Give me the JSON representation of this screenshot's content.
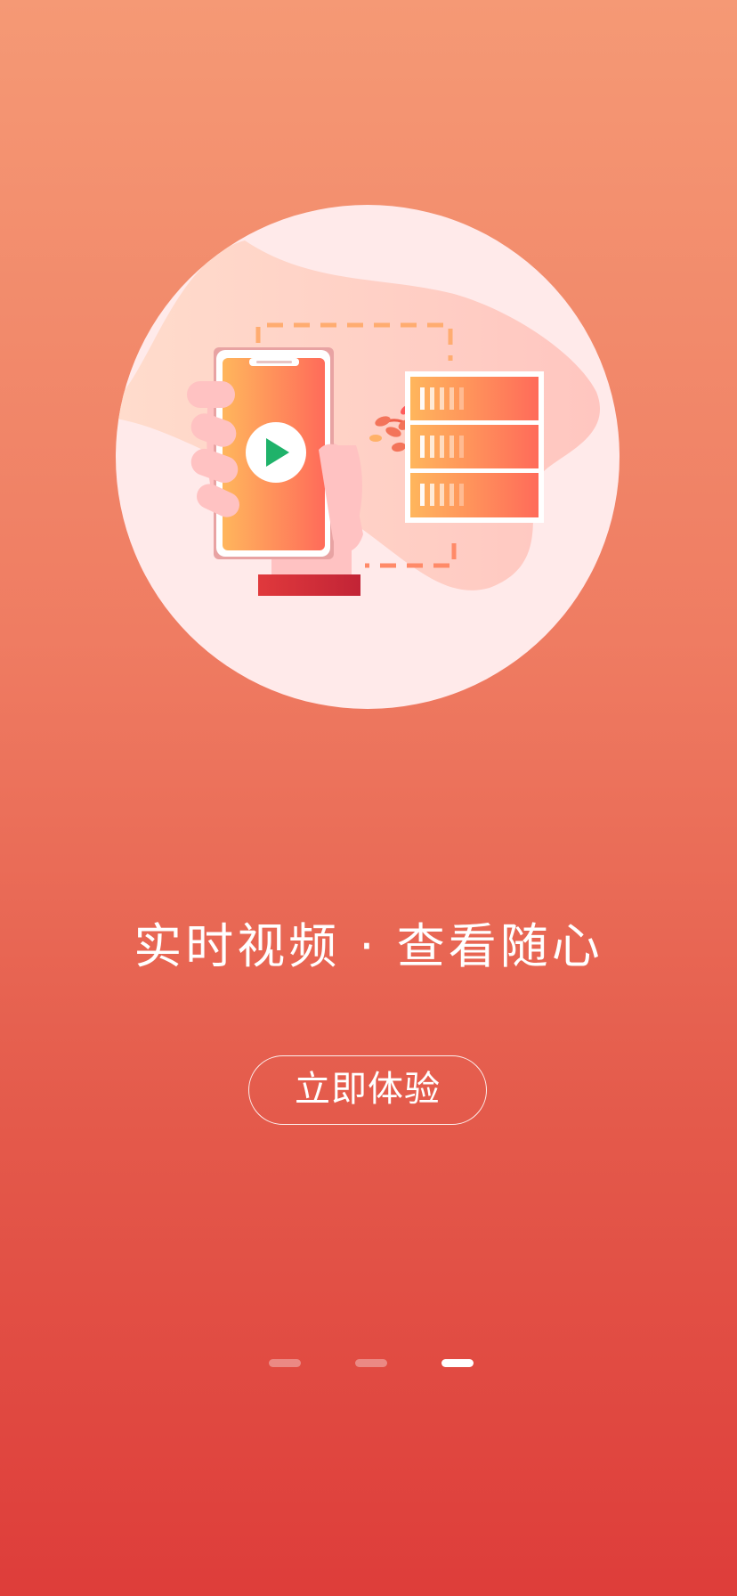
{
  "onboarding": {
    "headline": "实时视频 · 查看随心",
    "cta_label": "立即体验",
    "illustration": "phone-streaming-video-to-server-illustration"
  },
  "pager": {
    "page_count": 3,
    "current_page": 3,
    "pages": [
      {
        "label": "page-1",
        "active": false
      },
      {
        "label": "page-2",
        "active": false
      },
      {
        "label": "page-3",
        "active": true
      }
    ]
  },
  "colors": {
    "background_top": "#f59975",
    "background_bottom": "#de3d3a",
    "accent_green": "#1fb26a",
    "text": "#ffffff"
  }
}
